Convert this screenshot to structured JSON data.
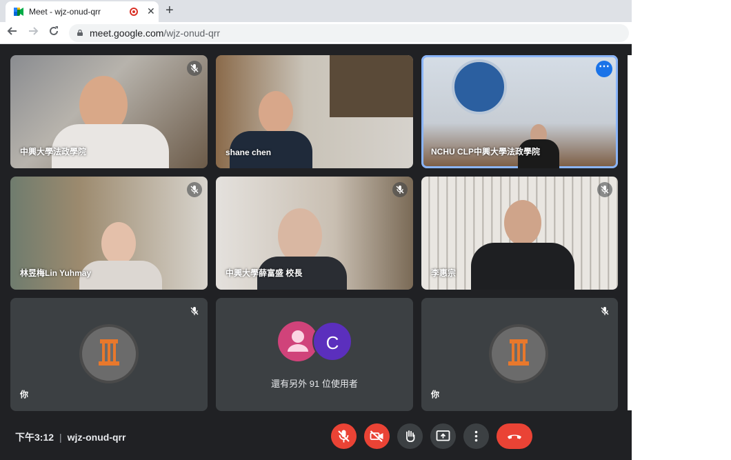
{
  "browser": {
    "tab_title": "Meet - wjz-onud-qrr",
    "close_glyph": "✕",
    "newtab_glyph": "+",
    "url_host": "meet.google.com",
    "url_path": "/wjz-onud-qrr"
  },
  "participants": [
    {
      "name": "中興大學法政學院",
      "muted": true
    },
    {
      "name": "shane chen",
      "muted": false
    },
    {
      "name": "NCHU CLP中興大學法政學院",
      "muted": false,
      "pinned_menu": true
    },
    {
      "name": "林昱梅Lin Yuhmay",
      "muted": true
    },
    {
      "name": "中興大學薛富盛 校長",
      "muted": true
    },
    {
      "name": "李惠宗",
      "muted": true
    },
    {
      "name": "你",
      "muted": true
    },
    {
      "others_label": "還有另外 91 位使用者",
      "avatar_letter": "C"
    },
    {
      "name": "你",
      "muted": true
    }
  ],
  "footer": {
    "time": "下午3:12",
    "separator": "|",
    "meeting_code": "wjz-onud-qrr"
  },
  "colors": {
    "background": "#202124",
    "tile": "#3c4043",
    "danger": "#ea4335",
    "active_outline": "#8ab4f8"
  },
  "icons": [
    "meet-favicon",
    "recording-icon",
    "back-icon",
    "forward-icon",
    "reload-icon",
    "lock-icon",
    "mic-off-icon",
    "more-icon",
    "camera-off-icon",
    "raise-hand-icon",
    "present-icon",
    "end-call-icon"
  ]
}
